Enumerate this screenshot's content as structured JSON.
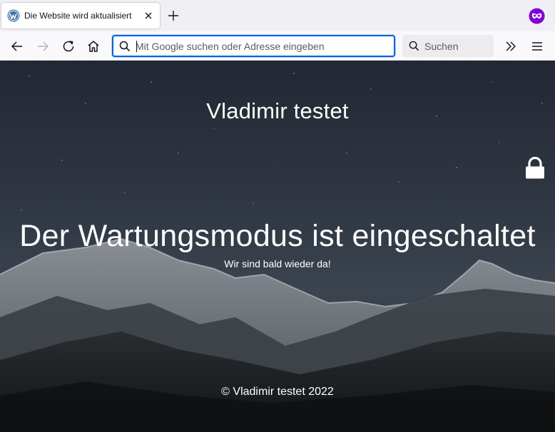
{
  "browser": {
    "tab": {
      "title": "Die Website wird aktualisiert",
      "favicon_icon": "wordpress-icon",
      "close_icon": "close-icon"
    },
    "new_tab_icon": "plus-icon",
    "private_mode_icon": "private-browsing-mask-icon",
    "nav": {
      "back_icon": "arrow-left-icon",
      "forward_icon": "arrow-right-icon",
      "reload_icon": "reload-icon",
      "home_icon": "home-icon",
      "overflow_icon": "chevron-double-right-icon",
      "menu_icon": "hamburger-menu-icon"
    },
    "urlbar": {
      "placeholder": "Mit Google suchen oder Adresse eingeben",
      "value": ""
    },
    "searchbox": {
      "label": "Suchen"
    },
    "colors": {
      "accent": "#0061e0",
      "private_purple": "#8000d7"
    }
  },
  "page": {
    "site_title": "Vladimir testet",
    "headline": "Der Wartungsmodus ist eingeschaltet",
    "subline": "Wir sind bald wieder da!",
    "footer": "© Vladimir testet 2022",
    "lock_icon": "lock-icon"
  }
}
